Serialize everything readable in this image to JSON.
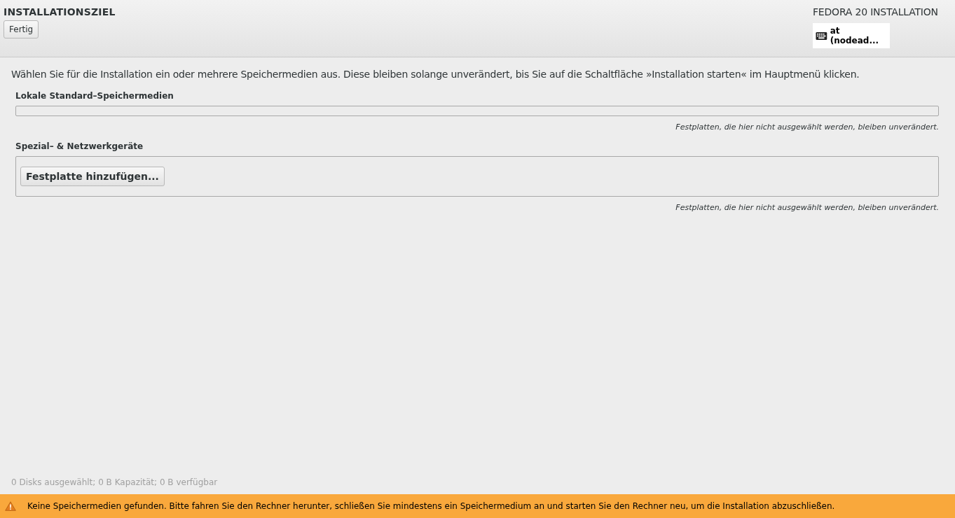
{
  "header": {
    "title": "INSTALLATIONSZIEL",
    "done_button": "Fertig",
    "product": "FEDORA 20 INSTALLATION",
    "keyboard_layout": "at (nodead..."
  },
  "intro": "Wählen Sie für die Installation ein oder mehrere Speichermedien aus. Diese bleiben solange unverändert, bis Sie auf die Schaltfläche »Installation starten« im Hauptmenü klicken.",
  "sections": [
    {
      "heading": "Lokale Standard–Speichermedien",
      "note": "Festplatten, die hier nicht ausgewählt werden, bleiben unverändert."
    },
    {
      "heading": "Spezial– & Netzwerkgeräte",
      "button": "Festplatte hinzufügen...",
      "note": "Festplatten, die hier nicht ausgewählt werden, bleiben unverändert."
    }
  ],
  "summary": "0 Disks ausgewählt; 0 B Kapazität; 0 B verfügbar",
  "warning": "Keine Speichermedien gefunden. Bitte fahren Sie den Rechner herunter, schließen Sie mindestens ein Speichermedium an und starten Sie den Rechner neu, um die Installation abzuschließen."
}
